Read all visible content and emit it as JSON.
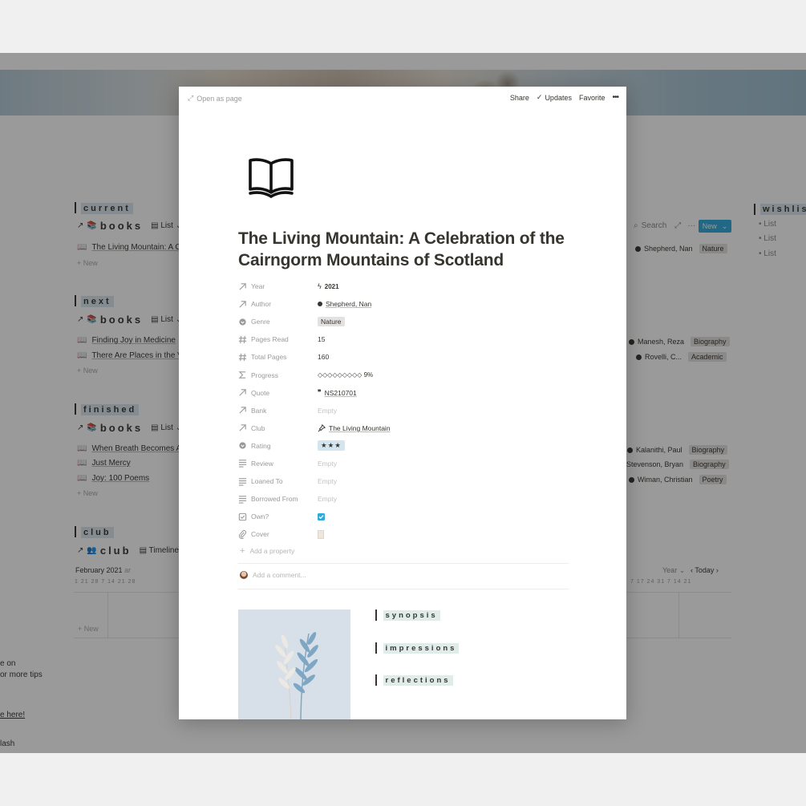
{
  "background": {
    "sections": [
      {
        "id": "current",
        "label": "current",
        "db_title": "books",
        "view": "List",
        "rows": [
          "The Living Mountain: A C"
        ],
        "new_label": "New"
      },
      {
        "id": "next",
        "label": "next",
        "db_title": "books",
        "view": "List",
        "rows": [
          "Finding Joy in Medicine",
          "There Are Places in the V"
        ],
        "new_label": "New"
      },
      {
        "id": "finished",
        "label": "finished",
        "db_title": "books",
        "view": "List",
        "rows": [
          "When Breath Becomes A",
          "Just Mercy",
          "Joy: 100 Poems"
        ],
        "new_label": "New"
      },
      {
        "id": "club",
        "label": "club",
        "db_title": "club",
        "view": "Timeline"
      }
    ],
    "toolbar": {
      "search": "Search",
      "more": "···",
      "new_button": "New"
    },
    "right_cells": [
      {
        "person": "Shepherd, Nan",
        "tag": "Nature"
      },
      {
        "person": "Manesh, Reza",
        "tag": "Biography"
      },
      {
        "person": "Rovelli, C...",
        "tag": "Academic"
      },
      {
        "person": "Kalanithi, Paul",
        "tag": "Biography"
      },
      {
        "person": "Stevenson, Bryan",
        "tag": "Biography"
      },
      {
        "person": "Wiman, Christian",
        "tag": "Poetry"
      }
    ],
    "wishlist": {
      "label": "wishlist",
      "items": [
        "List",
        "List",
        "List"
      ]
    },
    "timeline": {
      "month": "February 2021",
      "month_suffix": "ar",
      "days_left": "1  21  28   7   14  21  28",
      "days_right": "7  17  24  31   7   14  21",
      "year_label": "Year",
      "today_label": "Today",
      "new_label": "New"
    },
    "left_tips": [
      "e on",
      "or more tips",
      "e here!",
      "lash"
    ]
  },
  "modal": {
    "open_as_page": "Open as page",
    "actions": {
      "share": "Share",
      "updates": "Updates",
      "favorite": "Favorite",
      "more": "•••"
    },
    "title": "The Living Mountain: A Celebration of the Cairngorm Mountains of Scotland",
    "properties": [
      {
        "name": "Year",
        "icon": "arrow-up-right-icon",
        "value": "2021",
        "value_icon": "lightning-icon"
      },
      {
        "name": "Author",
        "icon": "arrow-up-right-icon",
        "value": "Shepherd, Nan",
        "value_icon": "person-icon"
      },
      {
        "name": "Genre",
        "icon": "select-icon",
        "value": "Nature",
        "style": "tag"
      },
      {
        "name": "Pages Read",
        "icon": "hash-icon",
        "value": "15"
      },
      {
        "name": "Total Pages",
        "icon": "hash-icon",
        "value": "160"
      },
      {
        "name": "Progress",
        "icon": "sigma-icon",
        "value": "◇◇◇◇◇◇◇◇◇ 9%"
      },
      {
        "name": "Quote",
        "icon": "arrow-up-right-icon",
        "value": "NS210701",
        "value_icon": "quote-icon"
      },
      {
        "name": "Bank",
        "icon": "arrow-up-right-icon",
        "value": "Empty",
        "style": "empty"
      },
      {
        "name": "Club",
        "icon": "arrow-up-right-icon",
        "value": "The Living Mountain",
        "value_icon": "pin-icon"
      },
      {
        "name": "Rating",
        "icon": "select-icon",
        "value": "★★★",
        "style": "tag-blue"
      },
      {
        "name": "Review",
        "icon": "text-icon",
        "value": "Empty",
        "style": "empty"
      },
      {
        "name": "Loaned To",
        "icon": "text-icon",
        "value": "Empty",
        "style": "empty"
      },
      {
        "name": "Borrowed From",
        "icon": "text-icon",
        "value": "Empty",
        "style": "empty"
      },
      {
        "name": "Own?",
        "icon": "checkbox-icon",
        "value": true,
        "style": "checkbox"
      },
      {
        "name": "Cover",
        "icon": "paperclip-icon",
        "style": "cover"
      }
    ],
    "add_property": "Add a property",
    "add_comment": "Add a comment...",
    "sections": [
      "synopsis",
      "impressions",
      "reflections"
    ]
  },
  "colors": {
    "accent_blue": "#2eaadc",
    "tag_gray": "#e3e2e0",
    "heading_highlight": "#dbe7ef"
  }
}
